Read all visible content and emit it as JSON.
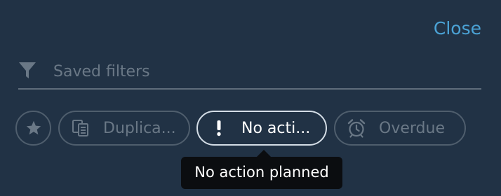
{
  "header": {
    "close_label": "Close"
  },
  "search": {
    "placeholder": "Saved filters",
    "value": ""
  },
  "filters": {
    "starred_icon": "star-icon",
    "items": [
      {
        "label": "Duplica...",
        "icon": "duplicate-icon",
        "selected": false
      },
      {
        "label": "No acti...",
        "icon": "exclamation-icon",
        "selected": true
      },
      {
        "label": "Overdue",
        "icon": "alarm-clock-icon",
        "selected": false
      }
    ]
  },
  "tooltip": {
    "text": "No action planned"
  },
  "colors": {
    "background": "#213245",
    "accent": "#4ba3d6",
    "pill_border": "#4f5e6d",
    "pill_selected_border": "#d4dde6",
    "muted_text": "#6a7886",
    "tooltip_bg": "#0b0d10"
  }
}
